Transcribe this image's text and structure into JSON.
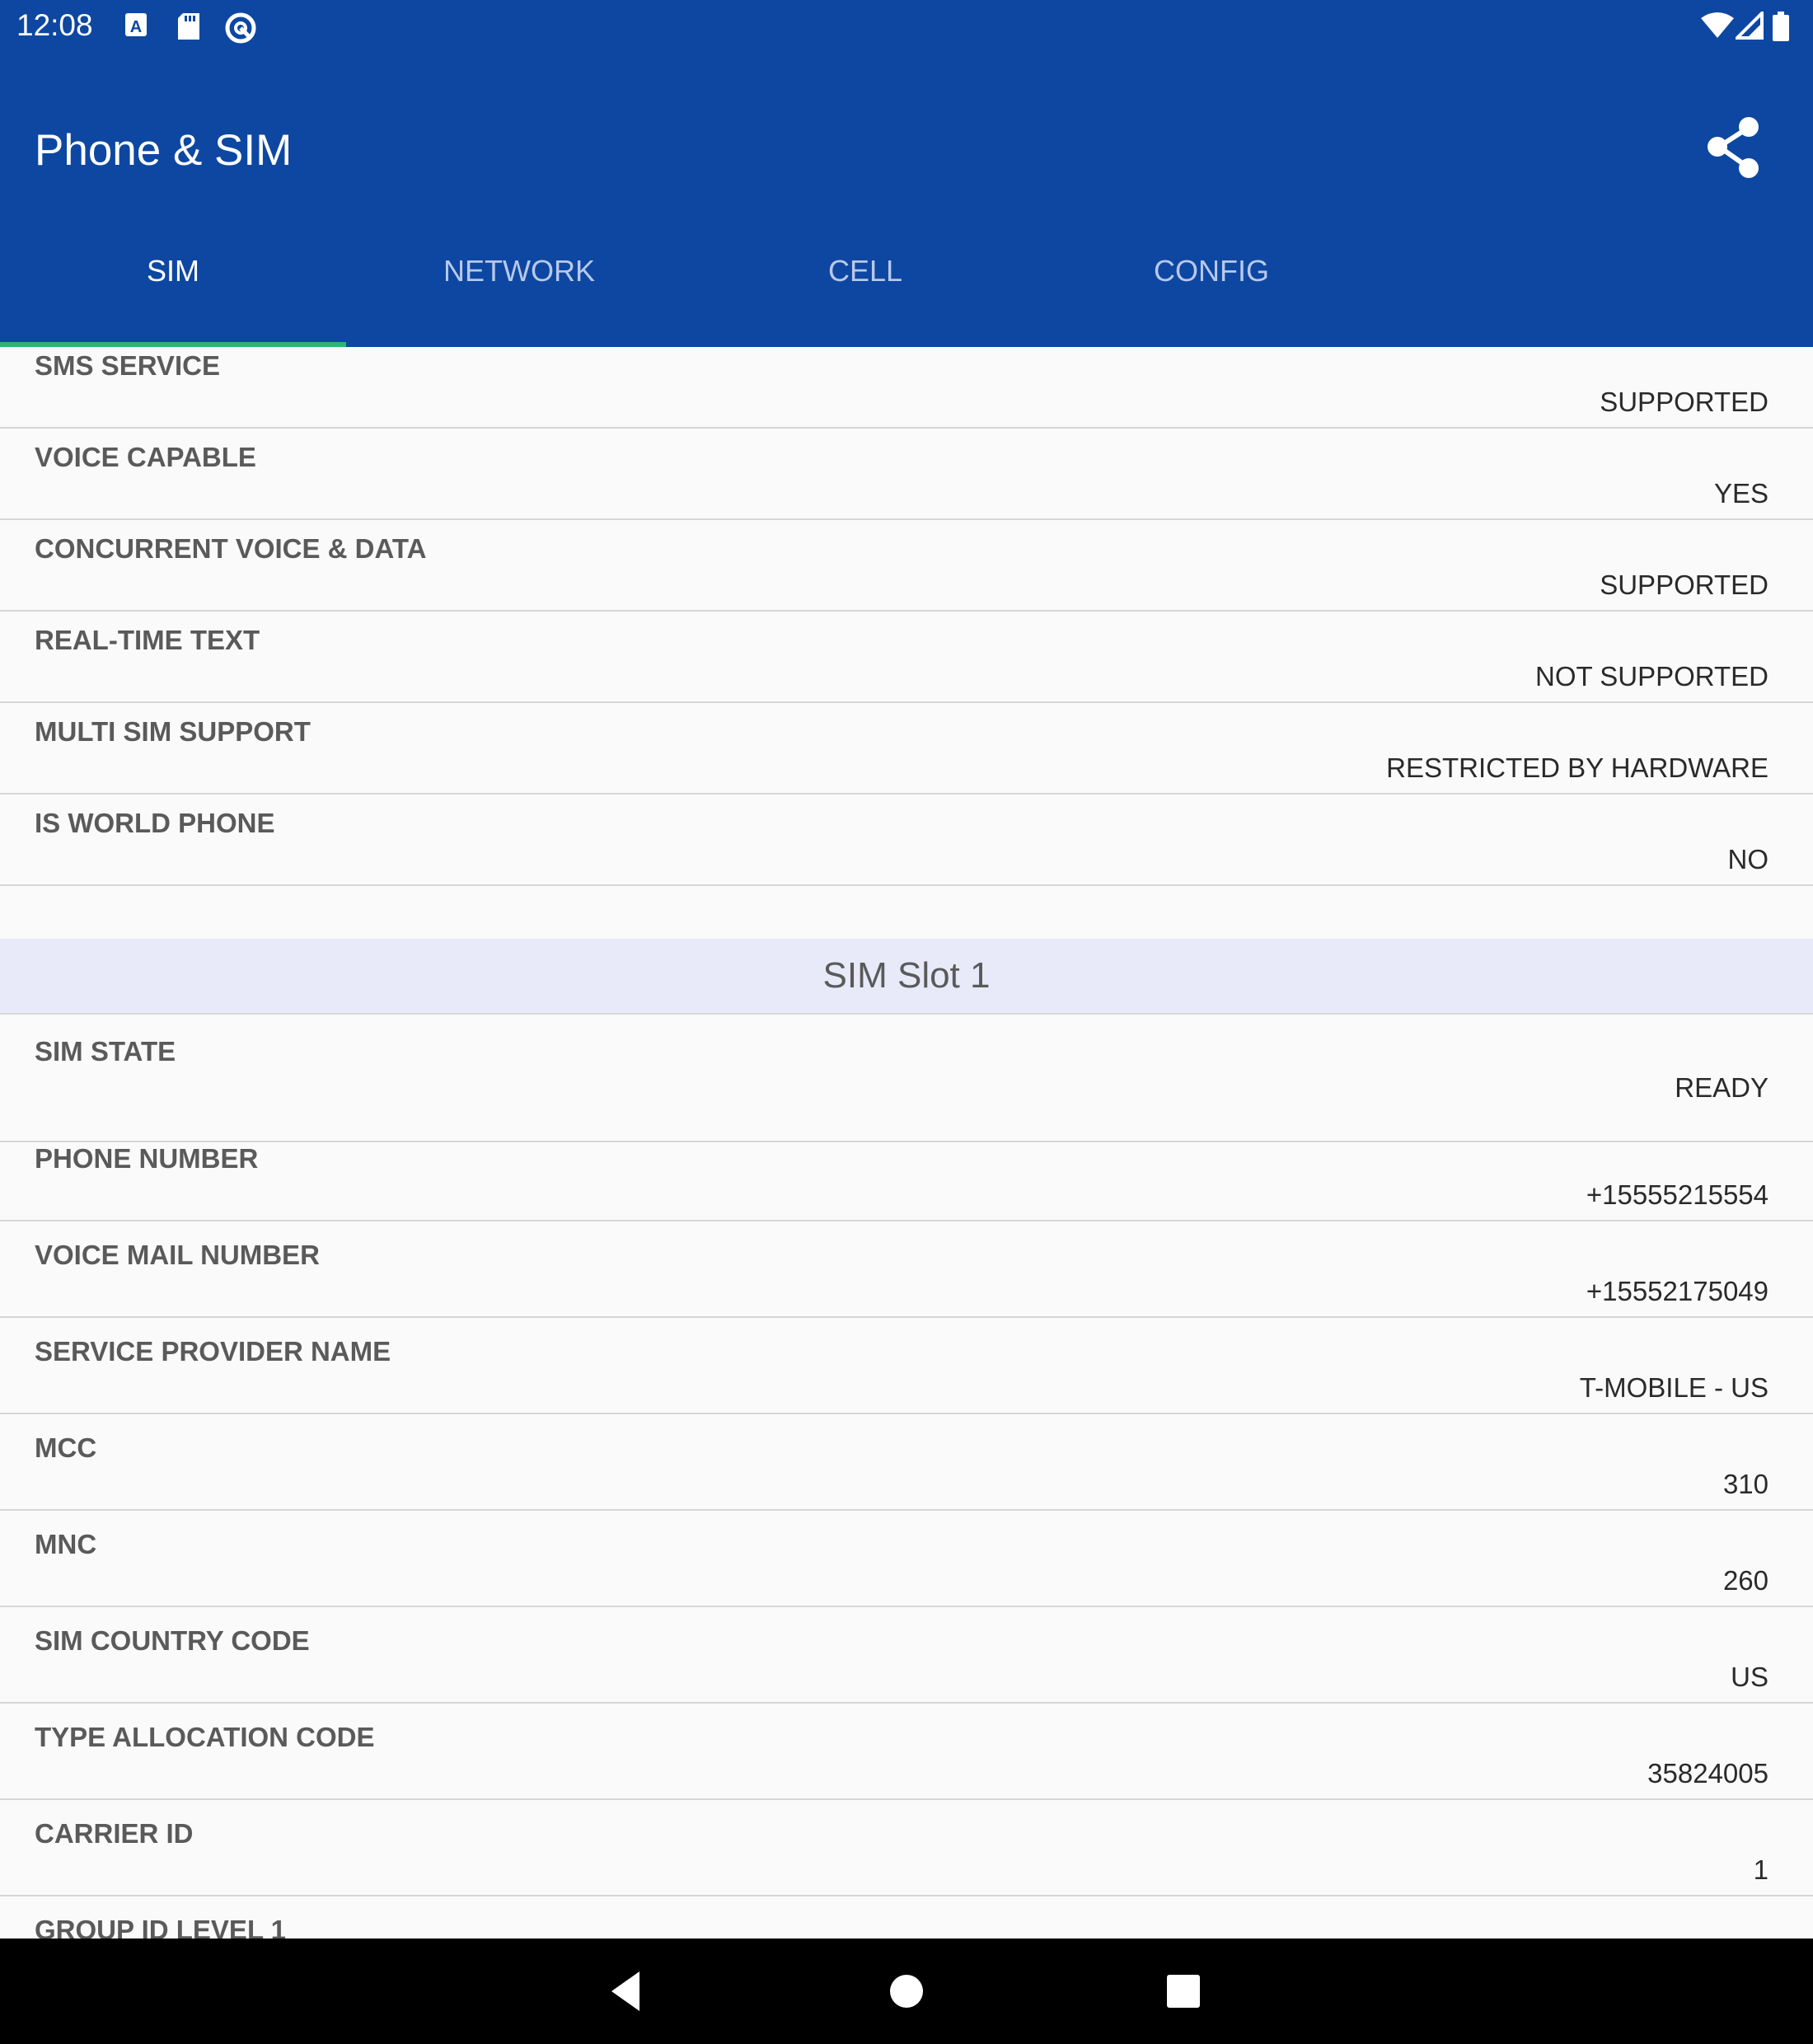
{
  "status_bar": {
    "time": "12:08",
    "left_icons": [
      "font-a-icon",
      "sd-card-icon",
      "sync-icon"
    ],
    "right_icons": [
      "wifi-icon",
      "cell-signal-icon",
      "battery-icon"
    ]
  },
  "app_bar": {
    "title": "Phone & SIM",
    "share_icon": "share-icon"
  },
  "tabs": [
    {
      "label": "SIM",
      "active": true
    },
    {
      "label": "NETWORK",
      "active": false
    },
    {
      "label": "CELL",
      "active": false
    },
    {
      "label": "CONFIG",
      "active": false
    }
  ],
  "general_rows": [
    {
      "label": "SMS SERVICE",
      "value": "SUPPORTED"
    },
    {
      "label": "VOICE CAPABLE",
      "value": "YES"
    },
    {
      "label": "CONCURRENT VOICE & DATA",
      "value": "SUPPORTED"
    },
    {
      "label": "REAL-TIME TEXT",
      "value": "NOT SUPPORTED"
    },
    {
      "label": "MULTI SIM SUPPORT",
      "value": "RESTRICTED BY HARDWARE"
    },
    {
      "label": "IS WORLD PHONE",
      "value": "NO"
    }
  ],
  "sim_slot": {
    "header": "SIM Slot 1",
    "rows": [
      {
        "label": "SIM STATE",
        "value": "READY"
      },
      {
        "label": "PHONE NUMBER",
        "value": "+15555215554"
      },
      {
        "label": "VOICE MAIL NUMBER",
        "value": "+15552175049"
      },
      {
        "label": "SERVICE PROVIDER NAME",
        "value": "T-MOBILE - US"
      },
      {
        "label": "MCC",
        "value": "310"
      },
      {
        "label": "MNC",
        "value": "260"
      },
      {
        "label": "SIM COUNTRY CODE",
        "value": "US"
      },
      {
        "label": "TYPE ALLOCATION CODE",
        "value": "35824005"
      },
      {
        "label": "CARRIER ID",
        "value": "1"
      },
      {
        "label": "GROUP ID LEVEL 1",
        "value": ""
      }
    ]
  },
  "nav_bar": {
    "buttons": [
      "back-icon",
      "home-icon",
      "recents-icon"
    ]
  }
}
